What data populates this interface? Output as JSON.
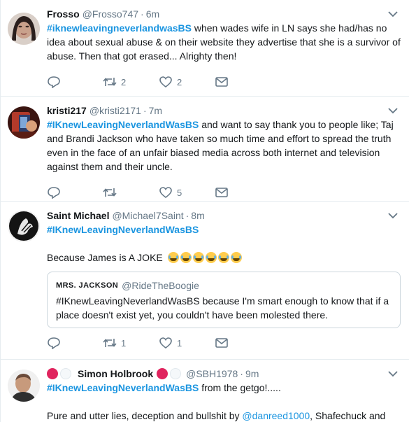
{
  "tweets": [
    {
      "name": "Frosso",
      "handle": "@Frosso747",
      "time": "6m",
      "hashtag": "#iknewleavingneverlandwasBS",
      "text": " when wades wife in LN says she had/has no idea about sexual abuse & on their website they advertise that she is a survivor of abuse. Then that got erased... Alrighty then!",
      "retweets": "2",
      "likes": "2"
    },
    {
      "name": "kristi217",
      "handle": "@kristi2171",
      "time": "7m",
      "hashtag": "#IKnewLeavingNeverlandWasBS",
      "text": " and want to say thank you to people like; Taj and Brandi Jackson who have taken so much time and effort to spread the truth even in the face of an unfair biased media across both internet and television against them and their uncle.",
      "retweets": "",
      "likes": "5"
    },
    {
      "name": "Saint Michael",
      "handle": "@Michael7Saint",
      "time": "8m",
      "hashtag": "#IKnewLeavingNeverlandWasBS",
      "text": "Because James is A JOKE",
      "retweets": "1",
      "likes": "1",
      "quote": {
        "name": "MRS. JACKSON",
        "handle": "@RideTheBoogie",
        "text": "#IKnewLeavingNeverlandWasBS because I'm smart enough to know that if a place doesn't exist yet, you couldn't have been molested there."
      }
    },
    {
      "name": "Simon Holbrook",
      "handle": "@SBH1978",
      "time": "9m",
      "hashtag": "#IKnewLeavingNeverlandWasBS",
      "text": " from the getgo!.....",
      "text2_pre": "Pure and utter lies, deception and bullshit by ",
      "mention": "@danreed1000",
      "text2_post": ", Shafechuck and"
    }
  ],
  "separator": "·",
  "colors": {
    "link": "#1b95e0",
    "meta": "#657786",
    "badge_red": "#e0245e",
    "badge_white": "#f5f8fa"
  },
  "icons": [
    "reply-icon",
    "retweet-icon",
    "like-icon",
    "dm-icon",
    "chevron-down-icon",
    "tears-of-joy-emoji"
  ]
}
